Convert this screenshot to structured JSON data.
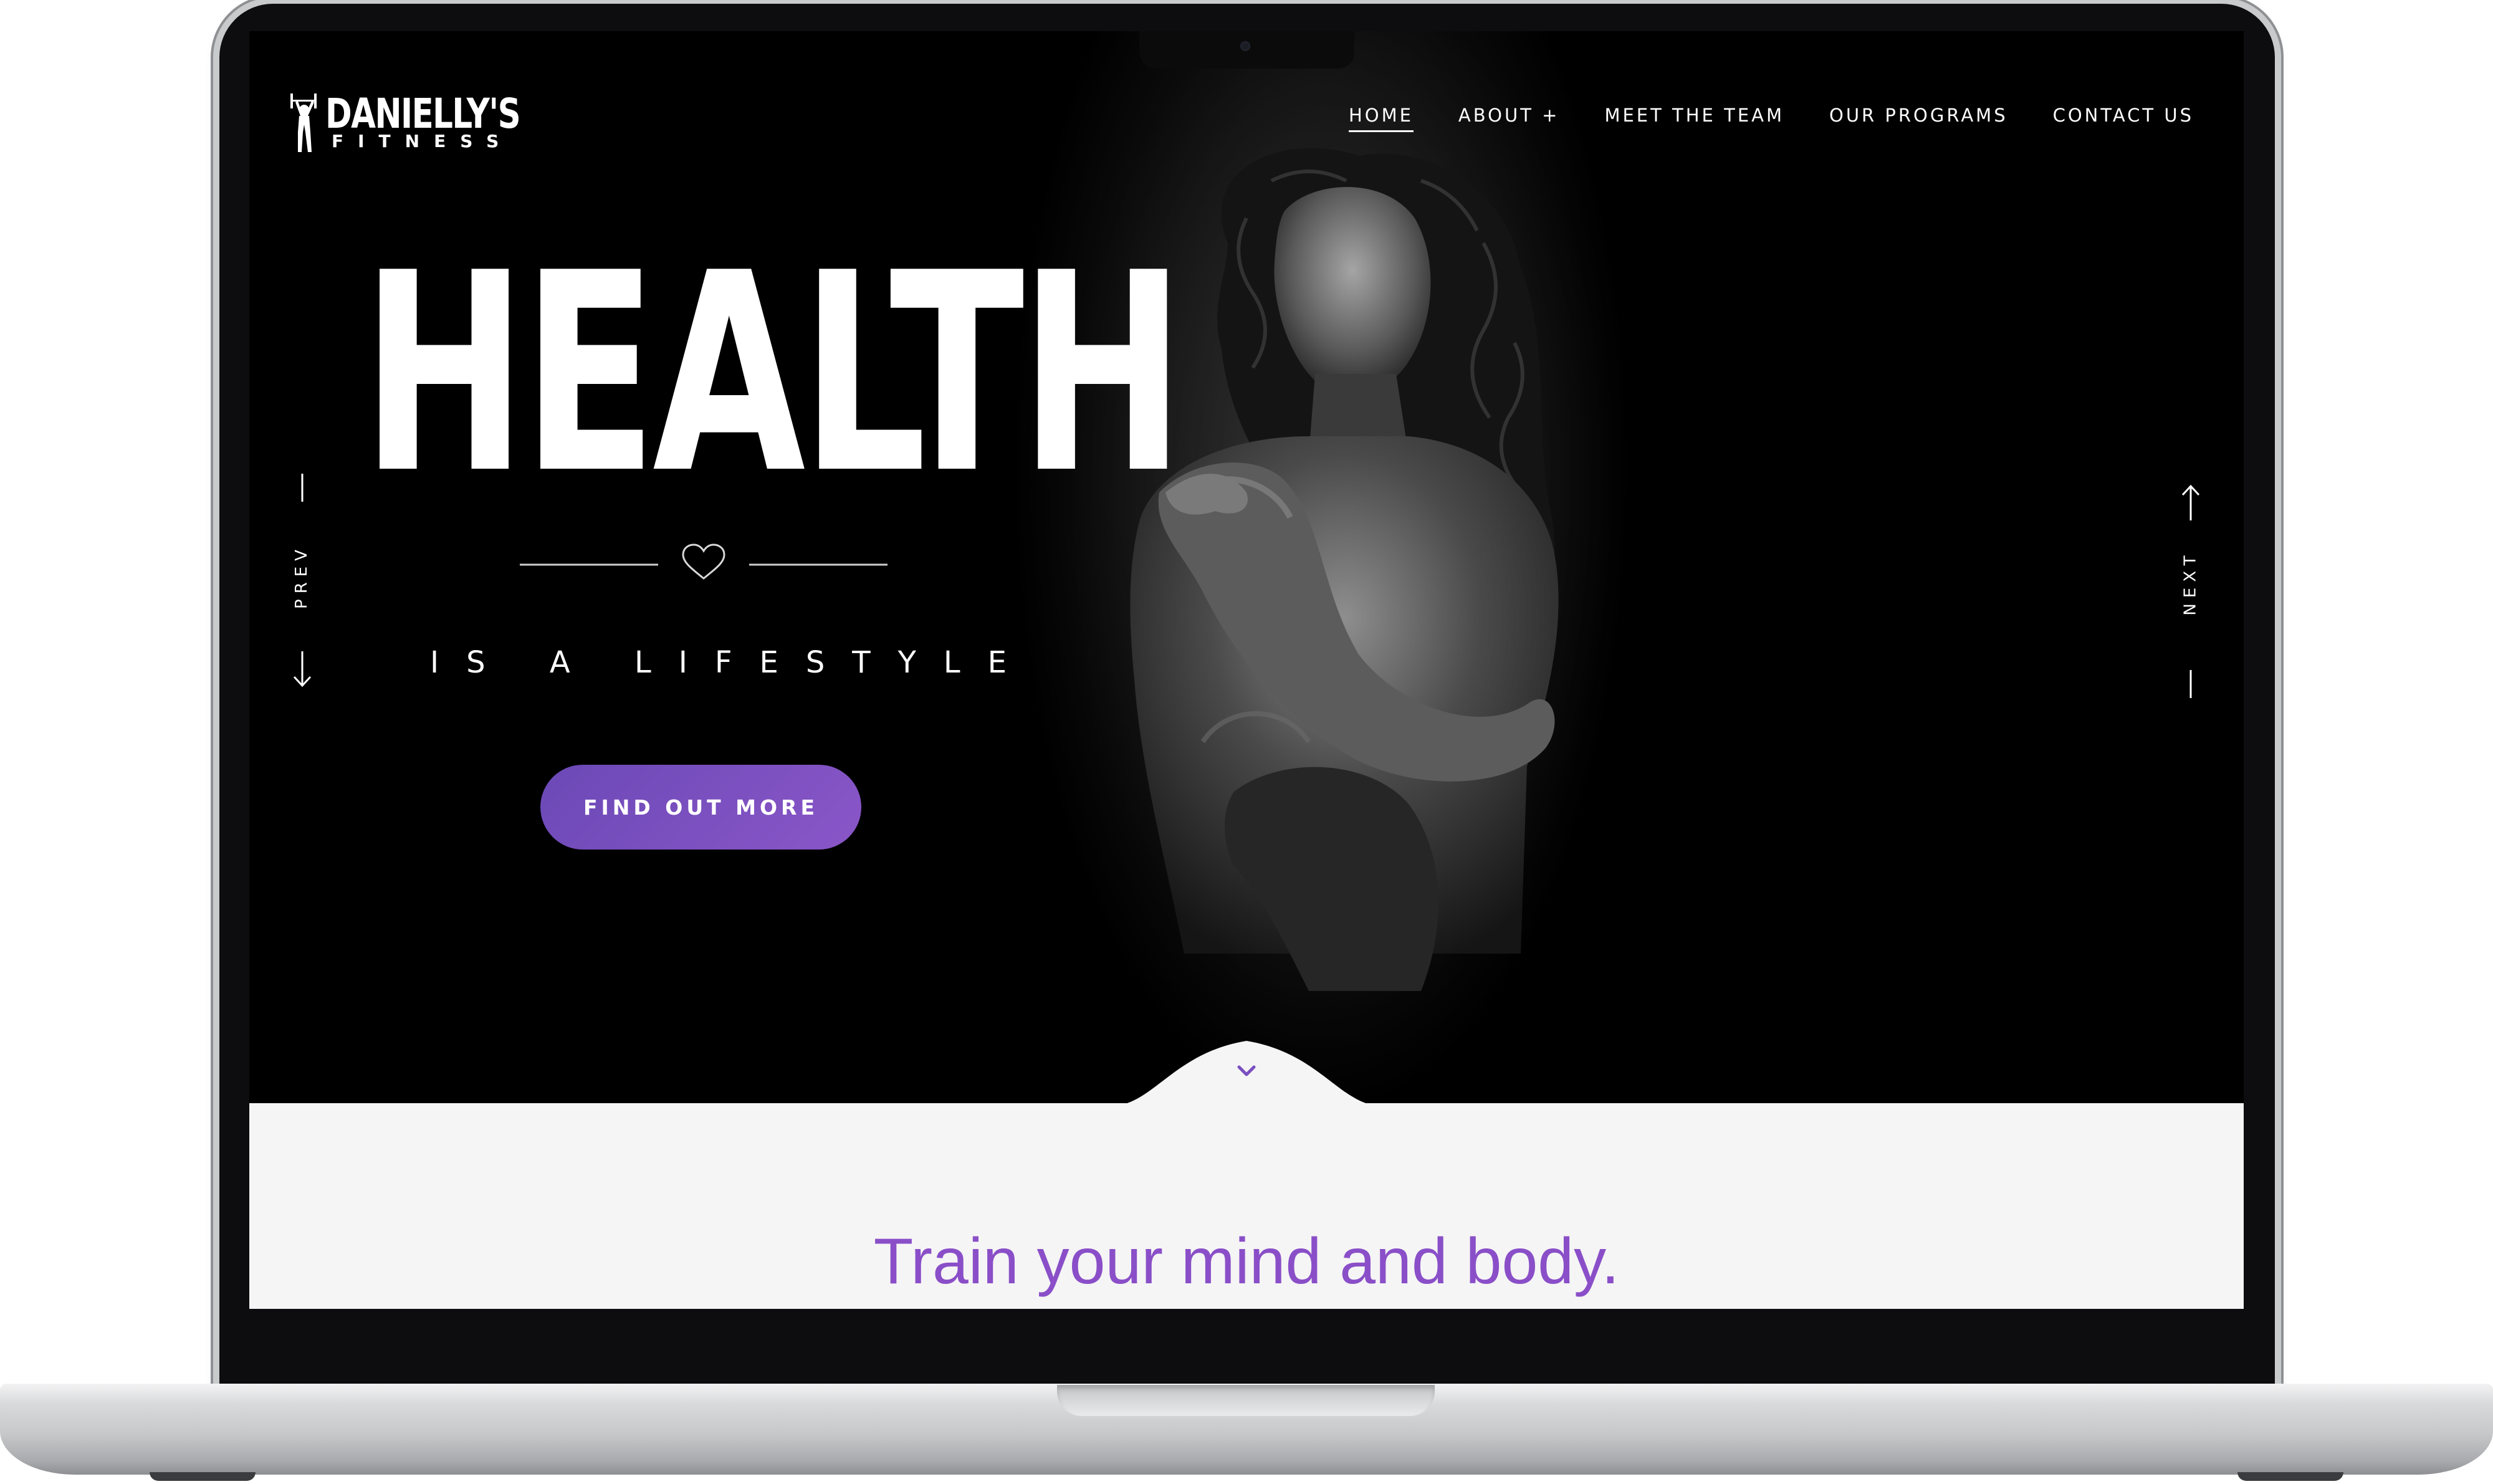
{
  "site": {
    "logo": {
      "title": "DANIELLY'S",
      "subtitle": "FITNESS"
    },
    "nav": [
      {
        "label": "HOME",
        "active": true
      },
      {
        "label": "ABOUT +",
        "active": false
      },
      {
        "label": "MEET THE TEAM",
        "active": false
      },
      {
        "label": "OUR PROGRAMS",
        "active": false
      },
      {
        "label": "CONTACT US",
        "active": false
      }
    ]
  },
  "hero": {
    "headline": "HEALTH",
    "tagline": "IS A LIFESTYLE",
    "cta": "FIND OUT MORE",
    "prev_label": "PREV",
    "next_label": "NEXT",
    "divider_icon": "heart-outline-icon",
    "scroll_icon": "chevron-down-icon"
  },
  "content": {
    "title": "Train your mind and body."
  },
  "colors": {
    "accent_purple": "#8a4fc8",
    "button_gradient_start": "#6b49b6",
    "button_gradient_end": "#8a56c8",
    "hero_background": "#000000",
    "section_background": "#f5f5f5"
  }
}
